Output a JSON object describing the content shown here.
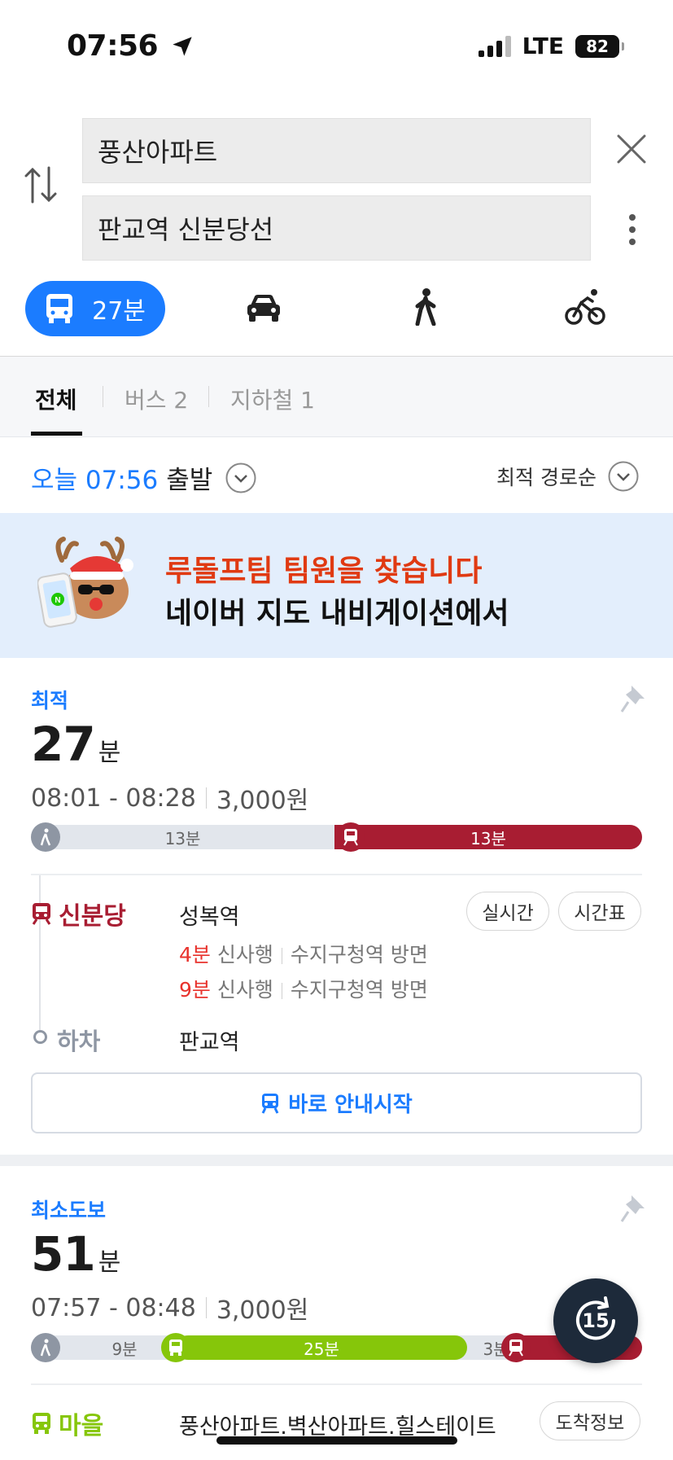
{
  "status": {
    "time": "07:56",
    "network": "LTE",
    "battery": "82"
  },
  "search": {
    "origin": "풍산아파트",
    "destination": "판교역 신분당선"
  },
  "modes": {
    "transit_label": "27분"
  },
  "tabs": [
    {
      "label": "전체"
    },
    {
      "label": "버스 2"
    },
    {
      "label": "지하철 1"
    }
  ],
  "departure": {
    "prefix": "오늘 07:56",
    "suffix": "출발",
    "sort": "최적 경로순"
  },
  "banner": {
    "line1": "루돌프팀 팀원을 찾습니다",
    "line2": "네이버 지도 내비게이션에서"
  },
  "route1": {
    "tag": "최적",
    "minutes": "27",
    "unit": "분",
    "times": "08:01 - 08:28",
    "fare": "3,000원",
    "segments": [
      {
        "type": "walk",
        "label": "13분",
        "fraction": 0.5
      },
      {
        "type": "subway",
        "label": "13분",
        "fraction": 0.5
      }
    ],
    "line_name": "신분당",
    "board_station": "성복역",
    "btn_realtime": "실시간",
    "btn_timetable": "시간표",
    "arrivals": [
      {
        "min": "4분",
        "dir": "신사행",
        "towards": "수지구청역 방면"
      },
      {
        "min": "9분",
        "dir": "신사행",
        "towards": "수지구청역 방면"
      }
    ],
    "alight_label": "하차",
    "alight_station": "판교역",
    "start_btn": "바로 안내시작"
  },
  "route2": {
    "tag": "최소도보",
    "minutes": "51",
    "unit": "분",
    "times": "07:57 - 08:48",
    "fare": "3,000원",
    "segments": [
      {
        "type": "walk",
        "label": "9분"
      },
      {
        "type": "bus",
        "label": "25분"
      },
      {
        "type": "walk",
        "label": "3분"
      },
      {
        "type": "subway",
        "label": ""
      }
    ],
    "line_name": "마을",
    "board_station": "풍산아파트.벽산아파트.힐스테이트",
    "btn_arrival": "도착정보"
  },
  "replay": {
    "label": "15"
  },
  "colors": {
    "accent": "#1b7cff",
    "subway": "#a81d32",
    "bus_green": "#86c60a",
    "walk": "#8e96a3"
  }
}
